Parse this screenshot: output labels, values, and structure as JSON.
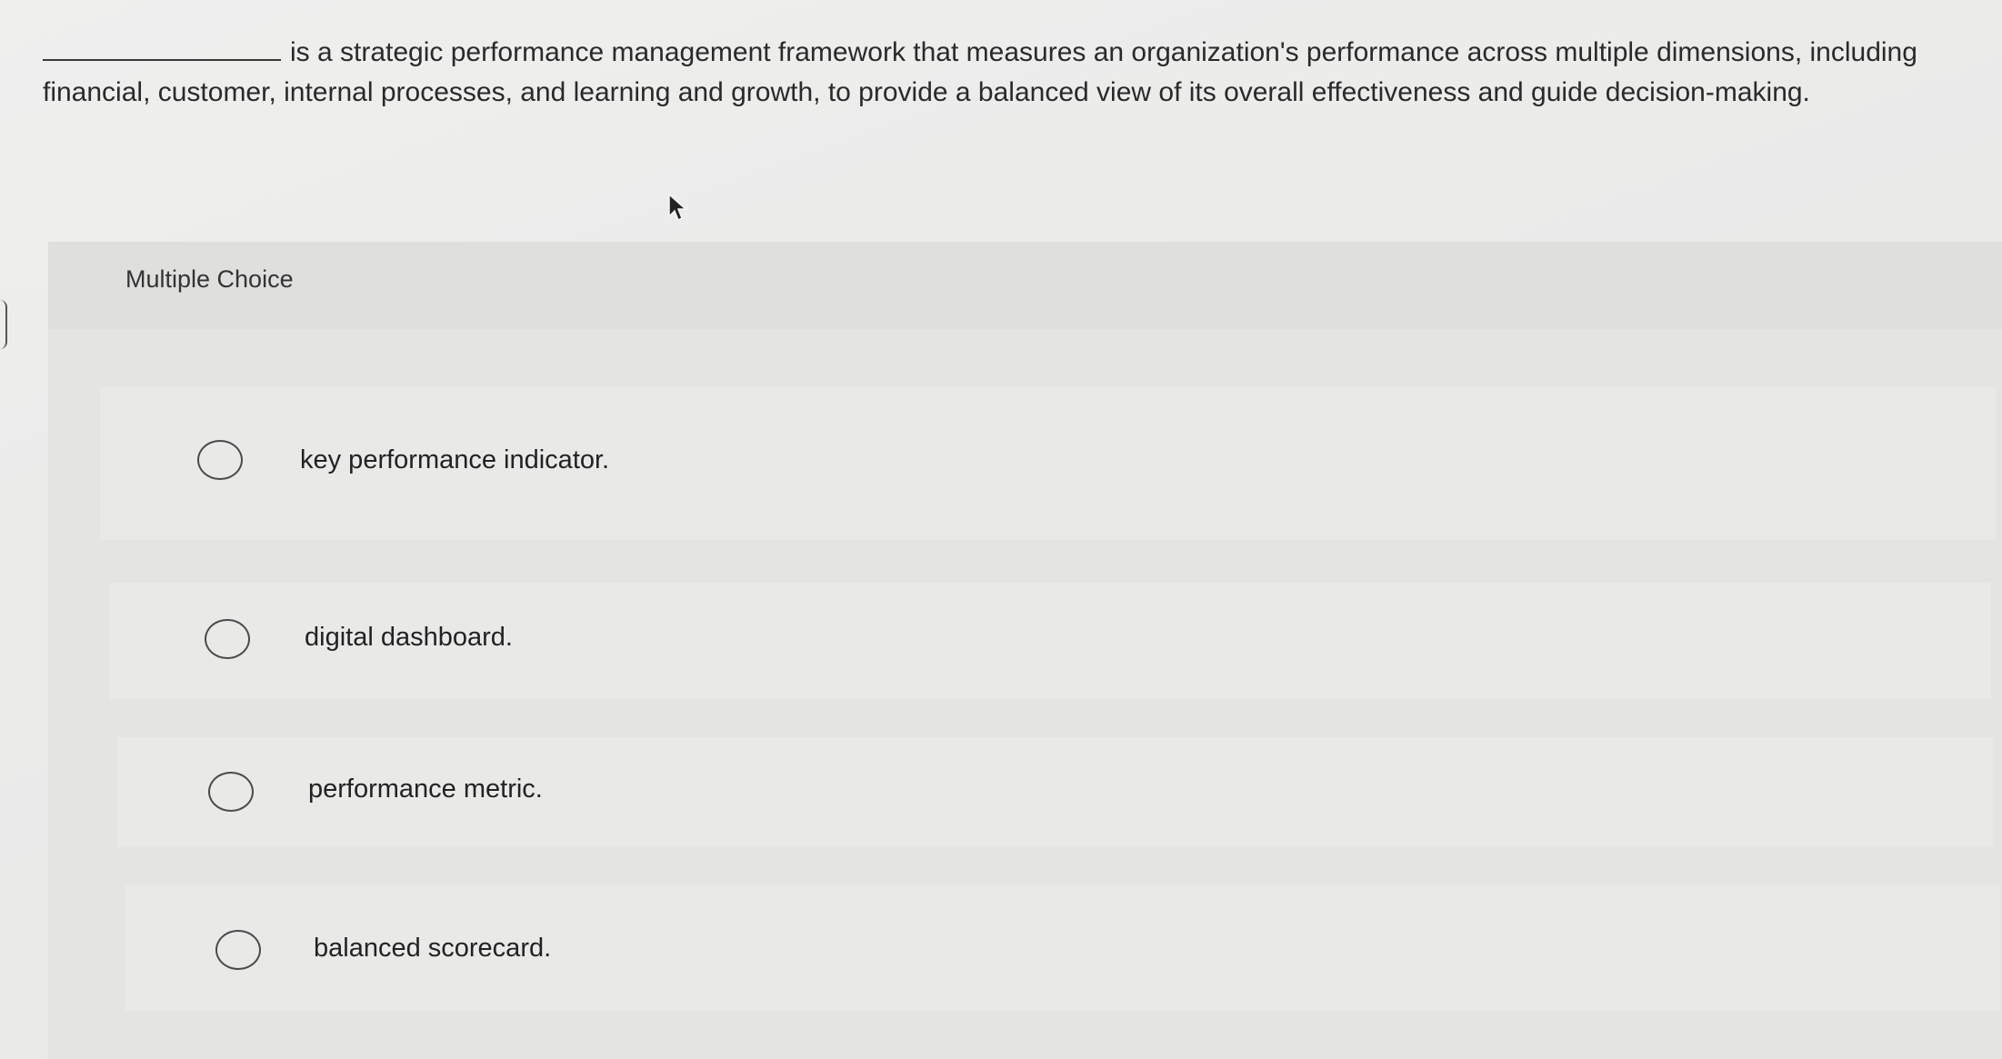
{
  "question": {
    "text": "is a strategic performance management framework that measures an organization's performance across multiple dimensions, including financial, customer, internal processes, and learning and growth, to provide a balanced view of its overall effectiveness and guide decision-making."
  },
  "panel": {
    "label": "Multiple Choice"
  },
  "choices": [
    {
      "label": "key performance indicator."
    },
    {
      "label": "digital dashboard."
    },
    {
      "label": "performance metric."
    },
    {
      "label": "balanced scorecard."
    }
  ],
  "icons": {
    "cursor": "mouse-pointer-icon",
    "radio": "radio-unselected-icon"
  }
}
